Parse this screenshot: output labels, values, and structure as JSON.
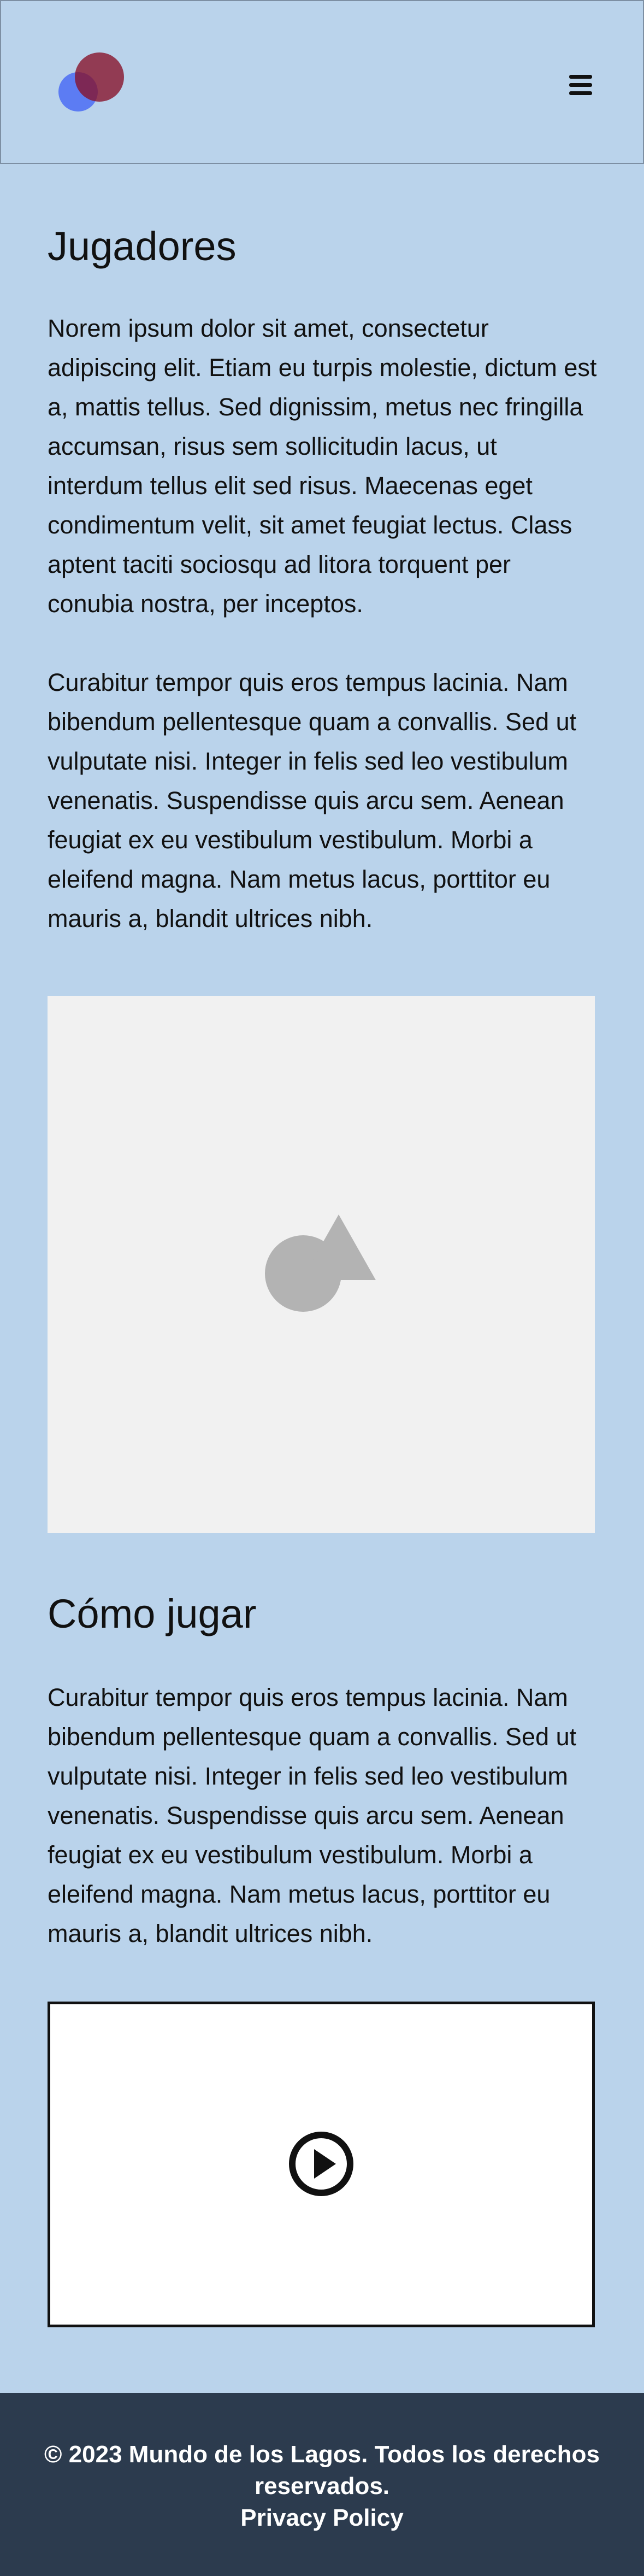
{
  "header": {
    "logo_colors": {
      "back_circle": "#5c7cf3",
      "front_circle": "#871128"
    },
    "menu_icon": "hamburger-icon"
  },
  "main": {
    "players": {
      "title": "Jugadores",
      "paragraphs": [
        "Norem ipsum dolor sit amet, consectetur adipiscing elit. Etiam eu turpis molestie, dictum est a, mattis tellus. Sed dignissim, metus nec fringilla accumsan, risus sem sollicitudin lacus, ut interdum tellus elit sed risus. Maecenas eget condimentum velit, sit amet feugiat lectus. Class aptent taciti sociosqu ad litora torquent per conubia nostra, per inceptos.",
        "Curabitur tempor quis eros tempus lacinia. Nam bibendum pellentesque quam a convallis. Sed ut vulputate nisi. Integer in felis sed leo vestibulum venenatis. Suspendisse quis arcu sem. Aenean feugiat ex eu vestibulum vestibulum. Morbi a eleifend magna. Nam metus lacus, porttitor eu mauris a, blandit ultrices nibh."
      ],
      "image_icon": "image-placeholder-icon"
    },
    "how_to_play": {
      "title": "Cómo jugar",
      "paragraph": "Curabitur tempor quis eros tempus lacinia. Nam bibendum pellentesque quam a convallis. Sed ut vulputate nisi. Integer in felis sed leo vestibulum venenatis. Suspendisse quis arcu sem. Aenean feugiat ex eu vestibulum vestibulum. Morbi a eleifend magna. Nam metus lacus, porttitor eu mauris a, blandit ultrices nibh.",
      "video_icon": "play-icon"
    }
  },
  "footer": {
    "copyright": "© 2023 Mundo de los Lagos. Todos los derechos reservados.",
    "privacy_link": "Privacy Policy"
  },
  "colors": {
    "page_background": "#bad3eb",
    "footer_background": "#2c3b4e",
    "placeholder_background": "#f1f1f1",
    "placeholder_icon": "#b3b3b3"
  }
}
